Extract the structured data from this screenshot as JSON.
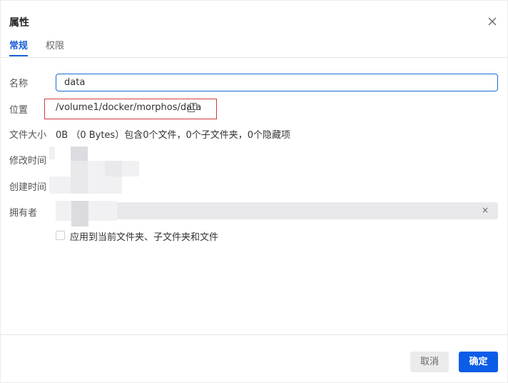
{
  "dialog": {
    "title": "属性",
    "close_icon": "close-icon"
  },
  "tabs": [
    {
      "label": "常规",
      "active": true
    },
    {
      "label": "权限",
      "active": false
    }
  ],
  "fields": {
    "name_label": "名称",
    "name_value": "data",
    "location_label": "位置",
    "location_value": "/volume1/docker/morphos/data",
    "copy_icon": "copy-icon",
    "size_label": "文件大小",
    "size_value": "0B （0 Bytes）包含0个文件，0个子文件夹，0个隐藏项",
    "modified_label": "修改时间",
    "created_label": "创建时间",
    "owner_label": "拥有者",
    "owner_clear": "×",
    "apply_checkbox_label": "应用到当前文件夹、子文件夹和文件",
    "apply_checked": false
  },
  "footer": {
    "cancel_label": "取消",
    "ok_label": "确定"
  },
  "colors": {
    "accent": "#0b5de8",
    "tab_active": "#1a5fd6",
    "highlight_border": "#d63a3a",
    "input_border": "#1a6bd6"
  }
}
